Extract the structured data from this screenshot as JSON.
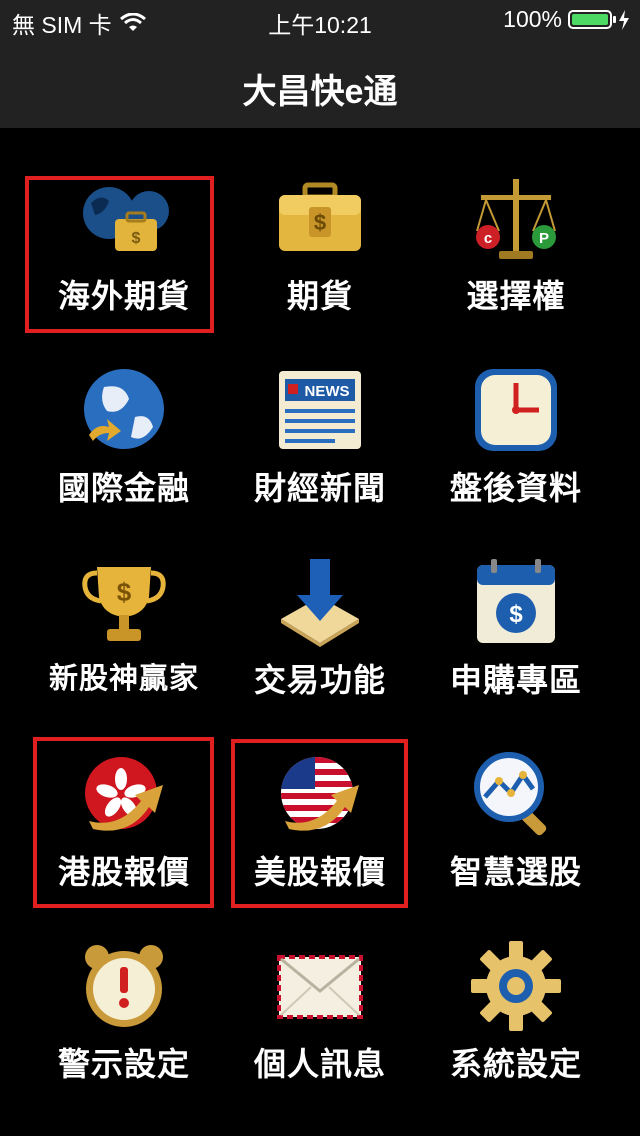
{
  "status": {
    "carrier": "無 SIM 卡",
    "time": "上午10:21",
    "battery_pct": "100%",
    "battery_color": "#4cd964"
  },
  "header": {
    "title": "大昌快e通"
  },
  "menu": [
    {
      "label": "海外期貨",
      "icon": "globe-briefcase-icon",
      "highlighted": true
    },
    {
      "label": "期貨",
      "icon": "briefcase-icon",
      "highlighted": false
    },
    {
      "label": "選擇權",
      "icon": "scale-icon",
      "highlighted": false
    },
    {
      "label": "國際金融",
      "icon": "globe-arrow-icon",
      "highlighted": false
    },
    {
      "label": "財經新聞",
      "icon": "newspaper-icon",
      "highlighted": false
    },
    {
      "label": "盤後資料",
      "icon": "clock-icon",
      "highlighted": false
    },
    {
      "label": "新股神贏家",
      "icon": "trophy-icon",
      "highlighted": false
    },
    {
      "label": "交易功能",
      "icon": "download-arrow-icon",
      "highlighted": false
    },
    {
      "label": "申購專區",
      "icon": "calendar-dollar-icon",
      "highlighted": false
    },
    {
      "label": "港股報價",
      "icon": "hk-flag-arrow-icon",
      "highlighted": true
    },
    {
      "label": "美股報價",
      "icon": "us-flag-arrow-icon",
      "highlighted": true
    },
    {
      "label": "智慧選股",
      "icon": "magnifier-chart-icon",
      "highlighted": false
    },
    {
      "label": "警示設定",
      "icon": "alarm-clock-icon",
      "highlighted": false
    },
    {
      "label": "個人訊息",
      "icon": "envelope-icon",
      "highlighted": false
    },
    {
      "label": "系統設定",
      "icon": "gear-icon",
      "highlighted": false
    }
  ],
  "colors": {
    "highlight": "#e02020",
    "bar": "#222222"
  }
}
